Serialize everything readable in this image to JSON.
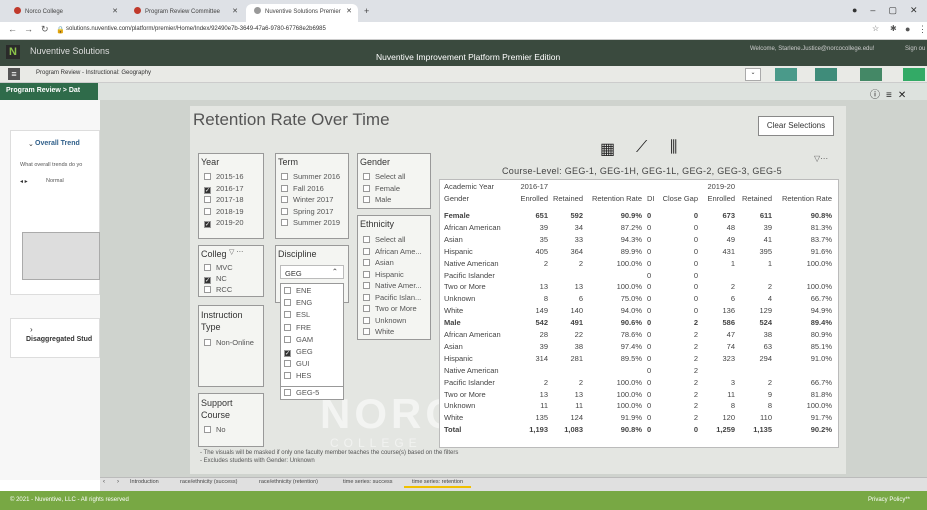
{
  "browser": {
    "tabs": [
      "Norco College",
      "Program Review Committee",
      "Nuventive Solutions Premier"
    ],
    "new_tab": "+",
    "url": "solutions.nuventive.com/platform/premier/Home/Index/92490e7b-3649-47a6-9780-67768e2b6985"
  },
  "app": {
    "name": "Nuventive Solutions",
    "platform_title": "Nuventive Improvement Platform Premier Edition",
    "welcome": "Welcome, Starlene.Justice@norcocollege.edu!",
    "signout": "Sign ou",
    "program": "Program Review - Instructional: Geography",
    "breadcrumb": "Program Review > Dat"
  },
  "left_panel": {
    "overall_title": "Overall Trend",
    "overall_question": "What overall trends do yo",
    "normal_label": "Normal",
    "disagg_title": "Disaggregated Stud"
  },
  "report": {
    "title": "Retention Rate Over Time",
    "clear_selections": "Clear Selections",
    "course_level": "Course-Level: GEG-1, GEG-1H, GEG-1L, GEG-2, GEG-3, GEG-5",
    "year": {
      "title": "Year",
      "options": [
        {
          "label": "2015-16",
          "checked": false
        },
        {
          "label": "2016-17",
          "checked": true
        },
        {
          "label": "2017-18",
          "checked": false
        },
        {
          "label": "2018-19",
          "checked": false
        },
        {
          "label": "2019-20",
          "checked": true
        }
      ]
    },
    "term": {
      "title": "Term",
      "options": [
        "Summer 2016",
        "Fall 2016",
        "Winter 2017",
        "Spring 2017",
        "Summer 2019"
      ]
    },
    "gender": {
      "title": "Gender",
      "options": [
        "Select all",
        "Female",
        "Male"
      ]
    },
    "college": {
      "title": "Colleg",
      "options": [
        {
          "label": "MVC",
          "checked": false
        },
        {
          "label": "NC",
          "checked": true
        },
        {
          "label": "RCC",
          "checked": false
        }
      ]
    },
    "discipline": {
      "title": "Discipline",
      "value": "GEG",
      "options": [
        {
          "label": "ENE",
          "checked": false
        },
        {
          "label": "ENG",
          "checked": false
        },
        {
          "label": "ESL",
          "checked": false
        },
        {
          "label": "FRE",
          "checked": false
        },
        {
          "label": "GAM",
          "checked": false
        },
        {
          "label": "GEG",
          "checked": true
        },
        {
          "label": "GUI",
          "checked": false
        },
        {
          "label": "HES",
          "checked": false
        }
      ]
    },
    "course": {
      "value": "GEG-5"
    },
    "ethnicity": {
      "title": "Ethnicity",
      "options": [
        "Select all",
        "African Ame...",
        "Asian",
        "Hispanic",
        "Native Amer...",
        "Pacific Islan...",
        "Two or More",
        "Unknown",
        "White"
      ]
    },
    "instruction": {
      "title": "Instruction Type",
      "option": "Non-Online"
    },
    "support": {
      "title": "Support Course",
      "option": "No"
    },
    "watermark": "NORCO",
    "watermark2": "COLLEGE",
    "notes": [
      "- The visuals will be masked if only one faculty member teaches the course(s) based on the filters",
      "- Excludes students with Gender: Unknown"
    ],
    "table": {
      "header1": [
        "Academic Year",
        "2016-17",
        "",
        "",
        "",
        "",
        "2019-20",
        "",
        ""
      ],
      "header2": [
        "Gender",
        "Enrolled",
        "Retained",
        "Retention Rate",
        "DI",
        "Close Gap",
        "Enrolled",
        "Retained",
        "Retention Rate"
      ],
      "rows": [
        {
          "bold": true,
          "indent": false,
          "cells": [
            "Female",
            "651",
            "592",
            "90.9%",
            "0",
            "0",
            "673",
            "611",
            "90.8%"
          ]
        },
        {
          "bold": false,
          "indent": true,
          "cells": [
            "African American",
            "39",
            "34",
            "87.2%",
            "0",
            "0",
            "48",
            "39",
            "81.3%"
          ]
        },
        {
          "bold": false,
          "indent": true,
          "cells": [
            "Asian",
            "35",
            "33",
            "94.3%",
            "0",
            "0",
            "49",
            "41",
            "83.7%"
          ]
        },
        {
          "bold": false,
          "indent": true,
          "cells": [
            "Hispanic",
            "405",
            "364",
            "89.9%",
            "0",
            "0",
            "431",
            "395",
            "91.6%"
          ]
        },
        {
          "bold": false,
          "indent": true,
          "cells": [
            "Native American",
            "2",
            "2",
            "100.0%",
            "0",
            "0",
            "1",
            "1",
            "100.0%"
          ]
        },
        {
          "bold": false,
          "indent": true,
          "cells": [
            "Pacific Islander",
            "",
            "",
            "",
            "0",
            "0",
            "",
            "",
            ""
          ]
        },
        {
          "bold": false,
          "indent": true,
          "cells": [
            "Two or More",
            "13",
            "13",
            "100.0%",
            "0",
            "0",
            "2",
            "2",
            "100.0%"
          ]
        },
        {
          "bold": false,
          "indent": true,
          "cells": [
            "Unknown",
            "8",
            "6",
            "75.0%",
            "0",
            "0",
            "6",
            "4",
            "66.7%"
          ]
        },
        {
          "bold": false,
          "indent": true,
          "cells": [
            "White",
            "149",
            "140",
            "94.0%",
            "0",
            "0",
            "136",
            "129",
            "94.9%"
          ]
        },
        {
          "bold": true,
          "indent": false,
          "cells": [
            "Male",
            "542",
            "491",
            "90.6%",
            "0",
            "2",
            "586",
            "524",
            "89.4%"
          ]
        },
        {
          "bold": false,
          "indent": true,
          "cells": [
            "African American",
            "28",
            "22",
            "78.6%",
            "0",
            "2",
            "47",
            "38",
            "80.9%"
          ]
        },
        {
          "bold": false,
          "indent": true,
          "cells": [
            "Asian",
            "39",
            "38",
            "97.4%",
            "0",
            "2",
            "74",
            "63",
            "85.1%"
          ]
        },
        {
          "bold": false,
          "indent": true,
          "cells": [
            "Hispanic",
            "314",
            "281",
            "89.5%",
            "0",
            "2",
            "323",
            "294",
            "91.0%"
          ]
        },
        {
          "bold": false,
          "indent": true,
          "cells": [
            "Native American",
            "",
            "",
            "",
            "0",
            "2",
            "",
            "",
            ""
          ]
        },
        {
          "bold": false,
          "indent": true,
          "cells": [
            "Pacific Islander",
            "2",
            "2",
            "100.0%",
            "0",
            "2",
            "3",
            "2",
            "66.7%"
          ]
        },
        {
          "bold": false,
          "indent": true,
          "cells": [
            "Two or More",
            "13",
            "13",
            "100.0%",
            "0",
            "2",
            "11",
            "9",
            "81.8%"
          ]
        },
        {
          "bold": false,
          "indent": true,
          "cells": [
            "Unknown",
            "11",
            "11",
            "100.0%",
            "0",
            "2",
            "8",
            "8",
            "100.0%"
          ]
        },
        {
          "bold": false,
          "indent": true,
          "cells": [
            "White",
            "135",
            "124",
            "91.9%",
            "0",
            "2",
            "120",
            "110",
            "91.7%"
          ]
        },
        {
          "bold": true,
          "indent": false,
          "cells": [
            "Total",
            "1,193",
            "1,083",
            "90.8%",
            "0",
            "0",
            "1,259",
            "1,135",
            "90.2%"
          ]
        }
      ]
    }
  },
  "page_tabs": [
    "Introduction",
    "race/ethnicity (success)",
    "race/ethnicity (retention)",
    "time series: success",
    "time series: retention"
  ],
  "footer": {
    "copyright": "© 2021 - Nuventive, LLC - All rights reserved",
    "privacy": "Privacy Policy**"
  },
  "colors": {
    "footer": "#78a844",
    "header": "#3a4a3e",
    "breadcrumb": "#2f6b4a"
  }
}
